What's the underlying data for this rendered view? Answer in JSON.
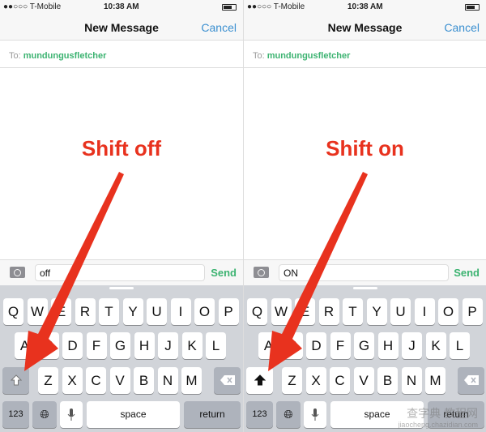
{
  "panels": [
    {
      "carrier": "●●○○○ T-Mobile",
      "time": "10:38 AM",
      "title": "New Message",
      "cancel": "Cancel",
      "to_label": "To:",
      "recipient": "mundungusfletcher",
      "heading": "Shift off",
      "message": "off",
      "send": "Send",
      "shift_on": false
    },
    {
      "carrier": "●●○○○ T-Mobile",
      "time": "10:38 AM",
      "title": "New Message",
      "cancel": "Cancel",
      "to_label": "To:",
      "recipient": "mundungusfletcher",
      "heading": "Shift on",
      "message": "ON",
      "send": "Send",
      "shift_on": true
    }
  ],
  "keyboard": {
    "rows": [
      [
        "Q",
        "W",
        "E",
        "R",
        "T",
        "Y",
        "U",
        "I",
        "O",
        "P"
      ],
      [
        "A",
        "S",
        "D",
        "F",
        "G",
        "H",
        "J",
        "K",
        "L"
      ],
      [
        "Z",
        "X",
        "C",
        "V",
        "B",
        "N",
        "M"
      ]
    ],
    "numbers": "123",
    "space": "space",
    "return": "return"
  },
  "colors": {
    "arrow": "#e8321e",
    "send": "#3cb371",
    "cancel": "#3a8fd0"
  },
  "watermark": {
    "line1": "查字典 教程网",
    "line2": "jiaocheng.chazidian.com"
  }
}
